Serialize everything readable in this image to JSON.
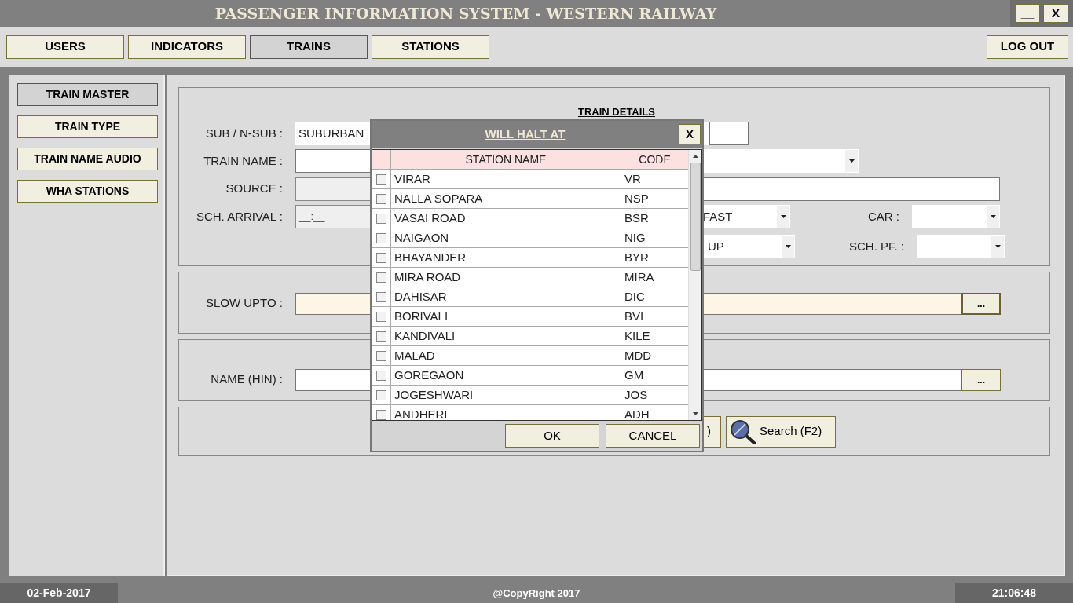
{
  "window": {
    "title": "PASSENGER INFORMATION SYSTEM - WESTERN RAILWAY",
    "minimize": "__",
    "close": "X"
  },
  "tabs": [
    {
      "label": "USERS",
      "selected": false
    },
    {
      "label": "INDICATORS",
      "selected": false
    },
    {
      "label": "TRAINS",
      "selected": true
    },
    {
      "label": "STATIONS",
      "selected": false
    }
  ],
  "logout": "LOG OUT",
  "sidebar": {
    "items": [
      {
        "label": "TRAIN MASTER",
        "selected": true
      },
      {
        "label": "TRAIN TYPE",
        "selected": false
      },
      {
        "label": "TRAIN NAME AUDIO",
        "selected": false
      },
      {
        "label": "WHA STATIONS",
        "selected": false
      }
    ]
  },
  "train_details": {
    "title": "TRAIN DETAILS",
    "sub_label": "SUB / N-SUB :",
    "sub_value": "SUBURBAN",
    "name_label": "TRAIN NAME :",
    "source_label": "SOURCE :",
    "arrival_label": "SCH. ARRIVAL :",
    "arrival_placeholder": "__:__",
    "speed_value": "FAST",
    "car_label": "CAR :",
    "direction_value": "UP",
    "pf_label": "SCH. PF. :"
  },
  "slow_upto": {
    "label": "SLOW UPTO :",
    "button": "..."
  },
  "name_hin": {
    "label": "NAME (HIN) :",
    "button": "..."
  },
  "actions": {
    "hidden_button": ")",
    "search": "Search (F2)"
  },
  "dialog": {
    "title": "WILL HALT AT",
    "close": "X",
    "columns": [
      "STATION NAME",
      "CODE"
    ],
    "ok": "OK",
    "cancel": "CANCEL",
    "rows": [
      {
        "name": "VIRAR",
        "code": "VR",
        "checked": false
      },
      {
        "name": "NALLA SOPARA",
        "code": "NSP",
        "checked": false
      },
      {
        "name": "VASAI ROAD",
        "code": "BSR",
        "checked": false
      },
      {
        "name": "NAIGAON",
        "code": "NIG",
        "checked": false
      },
      {
        "name": "BHAYANDER",
        "code": "BYR",
        "checked": false
      },
      {
        "name": "MIRA ROAD",
        "code": "MIRA",
        "checked": false
      },
      {
        "name": "DAHISAR",
        "code": "DIC",
        "checked": false
      },
      {
        "name": "BORIVALI",
        "code": "BVI",
        "checked": false
      },
      {
        "name": "KANDIVALI",
        "code": "KILE",
        "checked": false
      },
      {
        "name": "MALAD",
        "code": "MDD",
        "checked": false
      },
      {
        "name": "GOREGAON",
        "code": "GM",
        "checked": false
      },
      {
        "name": "JOGESHWARI",
        "code": "JOS",
        "checked": false
      },
      {
        "name": "ANDHERI",
        "code": "ADH",
        "checked": false
      }
    ]
  },
  "status_bar": {
    "date": "02-Feb-2017",
    "copyright": "@CopyRight 2017",
    "time": "21:06:48"
  }
}
